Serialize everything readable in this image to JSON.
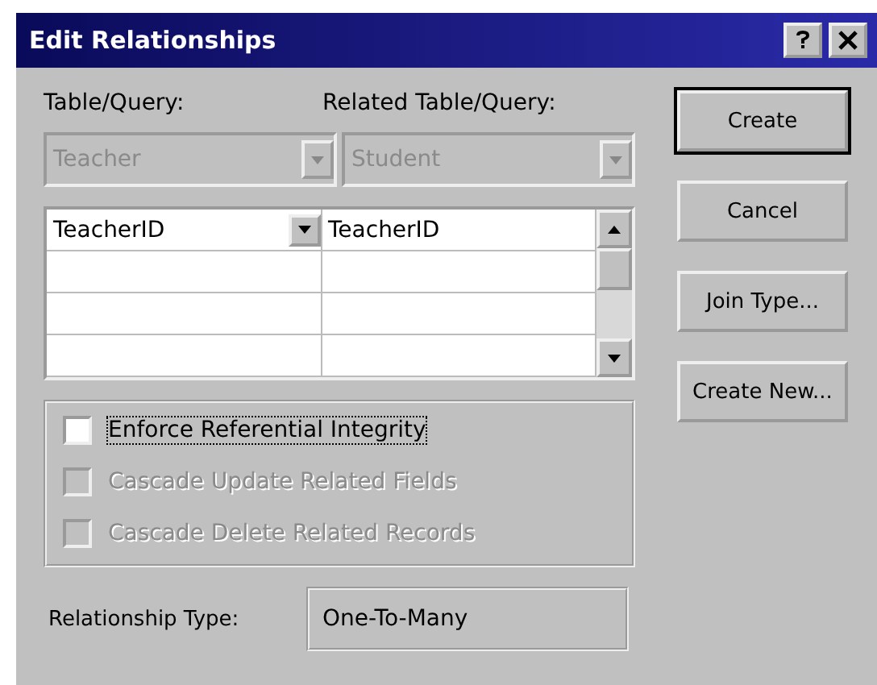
{
  "window": {
    "title": "Edit Relationships"
  },
  "table_query": {
    "label": "Table/Query:",
    "value": "Teacher",
    "disabled": true
  },
  "related_table_query": {
    "label": "Related Table/Query:",
    "value": "Student",
    "disabled": true
  },
  "field_rows": [
    {
      "field": "TeacherID",
      "related_field": "TeacherID"
    }
  ],
  "options": [
    {
      "label": "Enforce Referential Integrity",
      "checked": false,
      "disabled": false
    },
    {
      "label": "Cascade Update Related Fields",
      "checked": false,
      "disabled": true
    },
    {
      "label": "Cascade Delete Related Records",
      "checked": false,
      "disabled": true
    }
  ],
  "relationship_type": {
    "label": "Relationship Type:",
    "value": "One-To-Many"
  },
  "buttons": [
    {
      "label": "Create",
      "default": true
    },
    {
      "label": "Cancel",
      "default": false
    },
    {
      "label": "Join Type...",
      "default": false
    },
    {
      "label": "Create New...",
      "default": false
    }
  ]
}
